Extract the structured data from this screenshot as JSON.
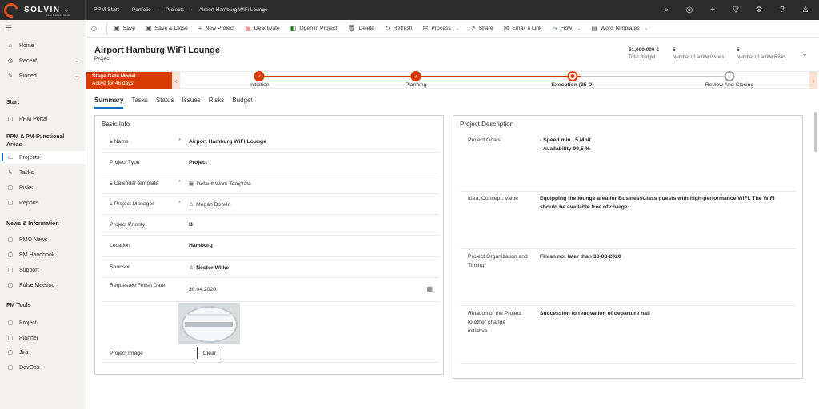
{
  "app": {
    "logo_text": "SOLVIN",
    "logo_tagline": "Keep Business Simple",
    "name": "PPM Start",
    "breadcrumb": [
      "Portfolio",
      "Projects",
      "Airport Hamburg WiFi Lounge"
    ],
    "top_icons": [
      "search-icon",
      "target-icon",
      "plus-icon",
      "filter-icon",
      "settings-icon",
      "help-icon",
      "user-icon"
    ]
  },
  "sidebar": {
    "top_items": [
      {
        "label": "Home",
        "icon": "home-icon"
      },
      {
        "label": "Recent",
        "icon": "clock-icon",
        "expandable": true
      },
      {
        "label": "Pinned",
        "icon": "pin-icon",
        "expandable": true
      }
    ],
    "groups": [
      {
        "title": "Start",
        "items": [
          {
            "label": "PPM Portal",
            "icon": "doc-icon"
          }
        ]
      },
      {
        "title": "PPM & PM-Functional Areas",
        "items": [
          {
            "label": "Projects",
            "icon": "projects-icon",
            "active": true
          },
          {
            "label": "Tasks",
            "icon": "tasks-icon"
          },
          {
            "label": "Risks",
            "icon": "risk-icon"
          },
          {
            "label": "Reports",
            "icon": "report-icon"
          }
        ]
      },
      {
        "title": "News & Information",
        "items": [
          {
            "label": "PMO News",
            "icon": "doc-icon"
          },
          {
            "label": "PM Handbook",
            "icon": "doc-icon"
          },
          {
            "label": "Support",
            "icon": "doc-icon"
          },
          {
            "label": "Pulse Meeting",
            "icon": "doc-icon"
          }
        ]
      },
      {
        "title": "PM Tools",
        "items": [
          {
            "label": "Project",
            "icon": "doc-icon"
          },
          {
            "label": "Planner",
            "icon": "doc-icon"
          },
          {
            "label": "Jira",
            "icon": "doc-icon"
          },
          {
            "label": "DevOps",
            "icon": "doc-icon"
          }
        ]
      }
    ]
  },
  "commands": [
    {
      "label": "Save",
      "icon": "save-icon"
    },
    {
      "label": "Save & Close",
      "icon": "save-close-icon"
    },
    {
      "label": "New Project",
      "icon": "plus-icon"
    },
    {
      "label": "Deactivate",
      "icon": "deactivate-icon"
    },
    {
      "label": "Open in Project",
      "icon": "project-icon"
    },
    {
      "label": "Delete",
      "icon": "delete-icon"
    },
    {
      "label": "Refresh",
      "icon": "refresh-icon"
    },
    {
      "label": "Process",
      "icon": "process-icon",
      "dropdown": true
    },
    {
      "label": "Share",
      "icon": "share-icon"
    },
    {
      "label": "Email a Link",
      "icon": "email-icon"
    },
    {
      "label": "Flow",
      "icon": "flow-icon",
      "dropdown": true
    },
    {
      "label": "Word Templates",
      "icon": "word-icon",
      "dropdown": true
    }
  ],
  "record": {
    "title": "Airport Hamburg WiFi Lounge",
    "entity": "Project",
    "kpis": [
      {
        "value": "61,000,000 €",
        "label": "Total Budget"
      },
      {
        "value": "5",
        "label": "Number of active Issues"
      },
      {
        "value": "5",
        "label": "Number of active Risks"
      }
    ]
  },
  "bpf": {
    "model": "Stage Gate Model",
    "status": "Active for 46 days",
    "stages": [
      {
        "label": "Initiation",
        "state": "done"
      },
      {
        "label": "Planning",
        "state": "done"
      },
      {
        "label": "Execution  (35 D)",
        "state": "current"
      },
      {
        "label": "Review And Closing",
        "state": "future"
      }
    ]
  },
  "tabs": [
    "Summary",
    "Tasks",
    "Status",
    "Issues",
    "Risks",
    "Budget"
  ],
  "basic_info": {
    "title": "Basic Info",
    "fields": {
      "name": {
        "label": "Name",
        "value": "Airport Hamburg WiFi Lounge"
      },
      "type": {
        "label": "Project Type",
        "value": "Project"
      },
      "calendar": {
        "label": "Calendar template",
        "value": "Default Work Template"
      },
      "manager": {
        "label": "Project Manager",
        "value": "Megan Bowen"
      },
      "priority": {
        "label": "Project Priority",
        "value": "B"
      },
      "location": {
        "label": "Location",
        "value": "Hamburg"
      },
      "sponsor": {
        "label": "Sponsor",
        "value": "Nestor Wilke"
      },
      "finish": {
        "label": "Requested Finish Date",
        "value": "30.04.2020"
      },
      "image": {
        "label": "Project Image",
        "clear_label": "Clear"
      }
    }
  },
  "description": {
    "title": "Project Description",
    "goals": {
      "label": "Project Goals",
      "lines": [
        "- Speed min.. 5 Mbit",
        "- Availability 99,5 %"
      ]
    },
    "idea": {
      "label": "Idea, Concept, Value",
      "value": "Equipping the lounge area for BusinessClass guests with high-performance WiFi. The WiFi should be available free of charge."
    },
    "org": {
      "label": "Project Organization and Timing",
      "value": "Finish not later than 30-08-2020"
    },
    "relation": {
      "label": "Relation of the Project to other change initiative",
      "value": "Succession to renovation of departure hall"
    }
  },
  "colors": {
    "accent": "#d83b01",
    "brand": "#e8501c",
    "link": "#0f6cbd",
    "topbar": "#2b2b2b"
  }
}
